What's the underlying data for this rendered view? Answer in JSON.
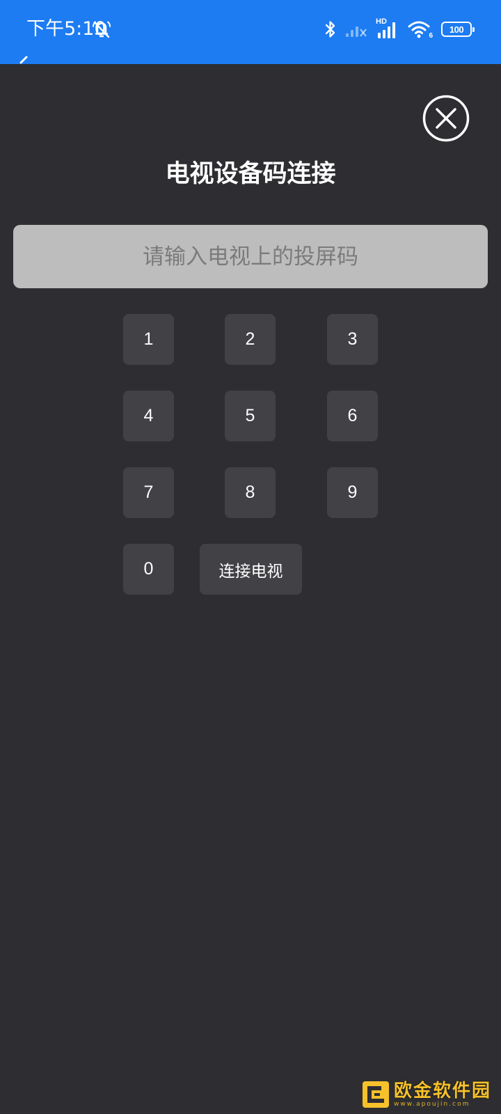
{
  "status_bar": {
    "time": "下午5:10",
    "hd_label": "HD",
    "wifi_label": "6",
    "battery": "100",
    "bg_color": "#1d7cf2"
  },
  "dialog": {
    "title": "电视设备码连接",
    "close_icon": "close-circle-icon",
    "input": {
      "placeholder": "请输入电视上的投屏码",
      "value": ""
    },
    "keys": [
      {
        "label": "1"
      },
      {
        "label": "2"
      },
      {
        "label": "3"
      },
      {
        "label": "4"
      },
      {
        "label": "5"
      },
      {
        "label": "6"
      },
      {
        "label": "7"
      },
      {
        "label": "8"
      },
      {
        "label": "9"
      },
      {
        "label": "0"
      }
    ],
    "connect_label": "连接电视",
    "bg_color": "#2e2e32",
    "key_color": "#414146"
  },
  "watermark": {
    "title": "欧金软件园",
    "url": "www.apoujin.com"
  }
}
